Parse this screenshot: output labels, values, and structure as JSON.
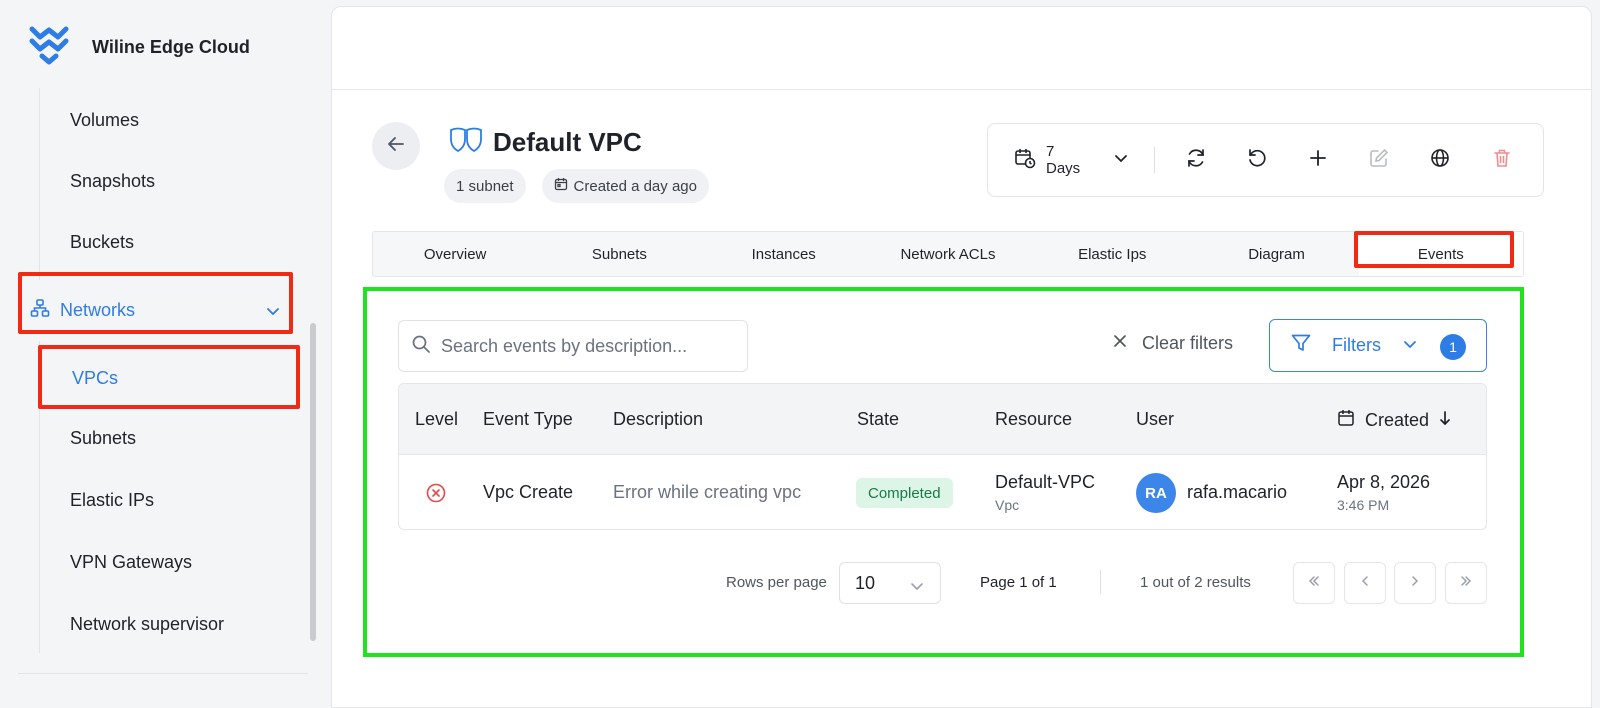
{
  "brand": {
    "name": "Wiline Edge Cloud",
    "logo_icon": "wiline-logo-icon"
  },
  "sidebar": {
    "items_above": [
      {
        "label": "Volumes"
      },
      {
        "label": "Snapshots"
      },
      {
        "label": "Buckets"
      }
    ],
    "group": {
      "label": "Networks",
      "icon": "network-icon",
      "expanded": true
    },
    "active_item": {
      "label": "VPCs"
    },
    "items_below": [
      {
        "label": "Subnets"
      },
      {
        "label": "Elastic IPs"
      },
      {
        "label": "VPN Gateways"
      },
      {
        "label": "Network supervisor"
      }
    ]
  },
  "header": {
    "title": "Default VPC",
    "title_icon": "vpc-shield-icon",
    "chips": {
      "subnets": "1 subnet",
      "created": "Created a day ago"
    }
  },
  "toolbar": {
    "range": "7 Days",
    "actions": [
      "refresh-icon",
      "reset-icon",
      "add-icon",
      "edit-icon",
      "globe-icon",
      "trash-icon"
    ]
  },
  "tabs": [
    {
      "label": "Overview"
    },
    {
      "label": "Subnets"
    },
    {
      "label": "Instances"
    },
    {
      "label": "Network ACLs"
    },
    {
      "label": "Elastic Ips"
    },
    {
      "label": "Diagram"
    },
    {
      "label": "Events",
      "active": true
    }
  ],
  "events": {
    "search_placeholder": "Search events by description...",
    "clear_filters": "Clear filters",
    "filters_label": "Filters",
    "filters_count": "1",
    "columns": {
      "level": "Level",
      "event_type": "Event Type",
      "description": "Description",
      "state": "State",
      "resource": "Resource",
      "user": "User",
      "created": "Created"
    },
    "rows": [
      {
        "level": "error",
        "event_type": "Vpc Create",
        "description": "Error while creating vpc",
        "state": "Completed",
        "resource": "Default-VPC",
        "resource_type": "Vpc",
        "user_initials": "RA",
        "user": "rafa.macario",
        "created_date": "Apr 8, 2026",
        "created_time": "3:46 PM"
      }
    ],
    "pagination": {
      "rows_per_page_label": "Rows per page",
      "rows_per_page": "10",
      "page_info": "Page 1 of 1",
      "results_info": "1 out of 2 results"
    }
  },
  "colors": {
    "accent": "#2e7de6",
    "annotation_red": "#f02a15",
    "annotation_green": "#1fe31f",
    "success_bg": "#dcf5e7",
    "success_text": "#1c7a45",
    "danger": "#e5484d"
  }
}
